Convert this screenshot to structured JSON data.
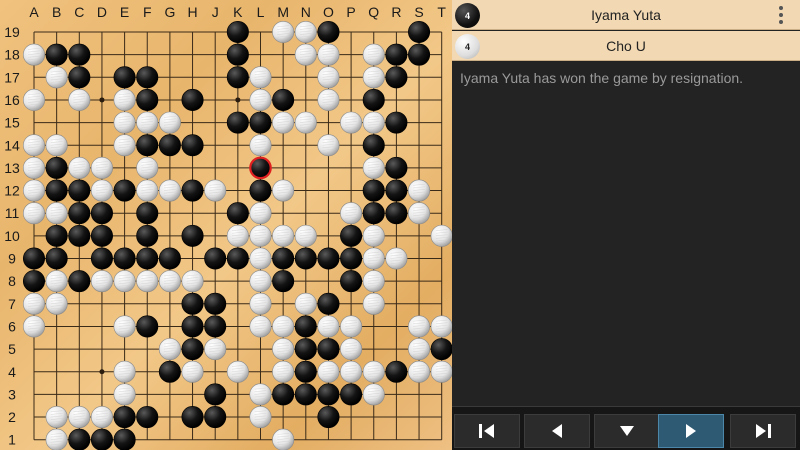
{
  "board": {
    "size": 19,
    "col_labels": [
      "A",
      "B",
      "C",
      "D",
      "E",
      "F",
      "G",
      "H",
      "J",
      "K",
      "L",
      "M",
      "N",
      "O",
      "P",
      "Q",
      "R",
      "S",
      "T"
    ],
    "row_labels": [
      "19",
      "18",
      "17",
      "16",
      "15",
      "14",
      "13",
      "12",
      "11",
      "10",
      "9",
      "8",
      "7",
      "6",
      "5",
      "4",
      "3",
      "2",
      "1"
    ],
    "last_move": "L13",
    "hoshi": [
      "D16",
      "K16",
      "Q16",
      "D10",
      "K10",
      "Q10",
      "D4",
      "K4",
      "Q4"
    ],
    "rows": [
      ".........B.WWB...B.",
      "WBB......B..WW.WBB.",
      ".WB.BB...BW..W.WB..",
      "W.W.WB.B..WB.W.B...",
      "....WWW..BBWW.WWB..",
      "WW..WBBB..W..W.B...",
      "WBWW.W....B....WB..",
      "WBBWBWWBW.BW...BBW.",
      "WWBB.B...BW...WBBW.",
      ".BBB.B.B.WWWW.BW..W",
      "BB.BBBB.BBWBBBBWW..",
      "BWBWWWWW..WB..BW...",
      "WW.....BB.W.WB.W...",
      "W...WB.BB.WWBWW..WW",
      "......WBW..WBBW..WBB",
      "....W.BW.W.WBWWWBWW",
      "....W...B.WBBBBW...",
      ".WWWBB.BB.W..B.....",
      ".WBBB......W......."
    ]
  },
  "players": [
    {
      "name": "Iyama Yuta",
      "color": "black",
      "captures": "4"
    },
    {
      "name": "Cho U",
      "color": "white",
      "captures": "4"
    }
  ],
  "comment": "Iyama Yuta has won the game by resignation.",
  "nav": [
    {
      "icon": "first-move-icon",
      "active": false
    },
    {
      "icon": "previous-move-icon",
      "active": false
    },
    {
      "icon": "variation-down-icon",
      "active": false
    },
    {
      "icon": "next-move-icon",
      "active": true
    },
    {
      "icon": "last-move-icon",
      "active": false
    }
  ]
}
